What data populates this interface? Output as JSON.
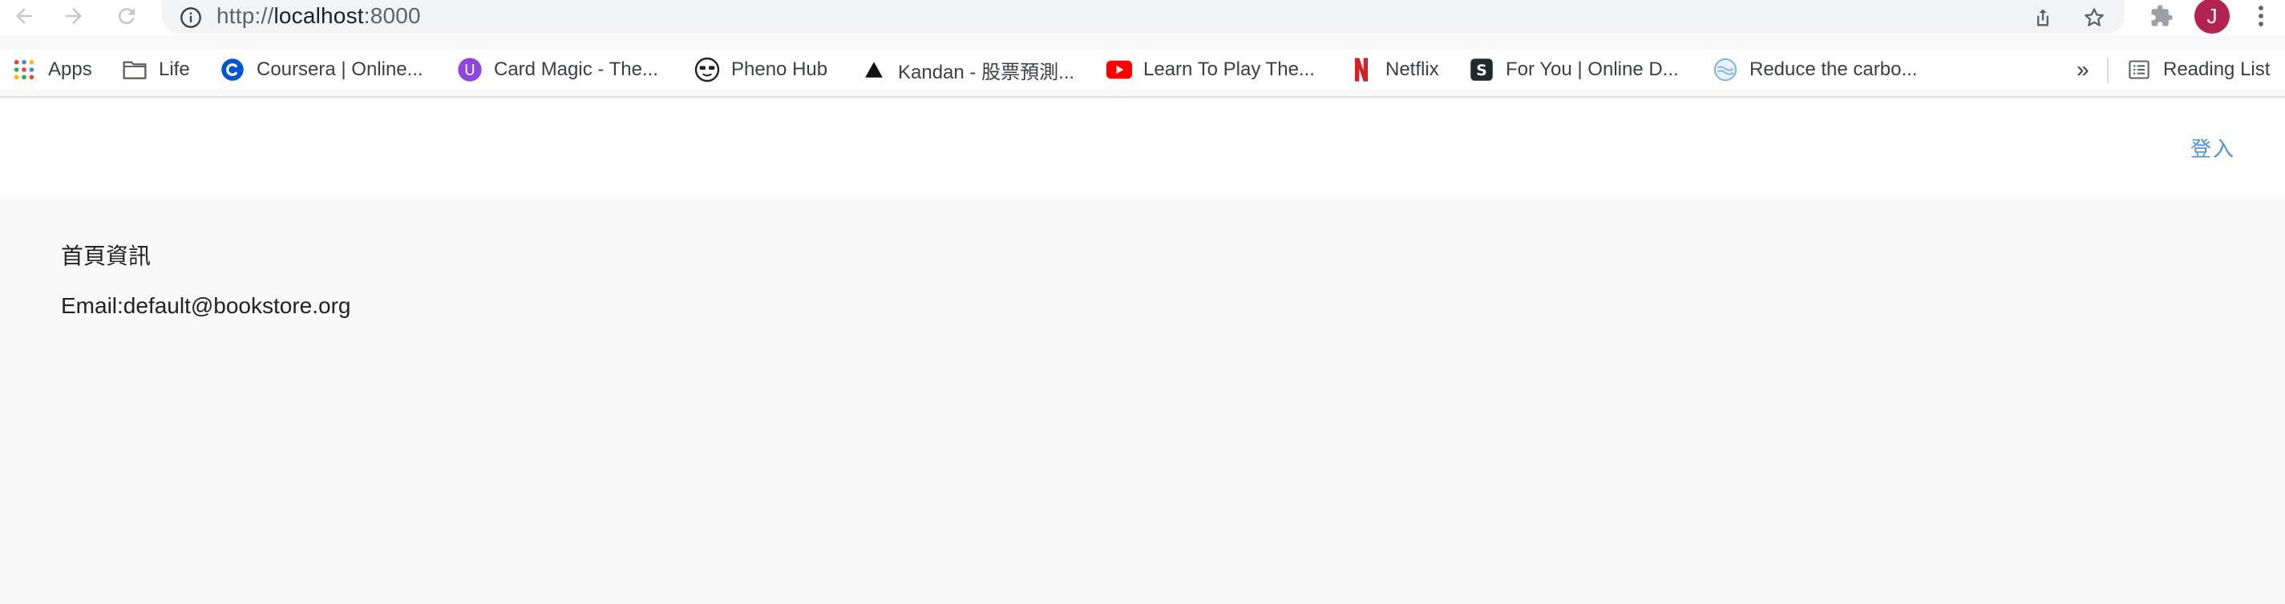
{
  "browser": {
    "url_prefix": "http://",
    "url_host": "localhost",
    "url_suffix": ":8000",
    "avatar_initial": "J"
  },
  "bookmarks": {
    "items": [
      {
        "label": "Apps",
        "icon": "apps-grid-icon"
      },
      {
        "label": "Life",
        "icon": "folder-icon"
      },
      {
        "label": "Coursera | Online...",
        "icon": "coursera-icon"
      },
      {
        "label": "Card Magic - The...",
        "icon": "card-magic-icon"
      },
      {
        "label": "Pheno Hub",
        "icon": "pheno-hub-icon"
      },
      {
        "label": "Kandan - 股票預測...",
        "icon": "kandan-icon"
      },
      {
        "label": "Learn To Play The...",
        "icon": "youtube-icon"
      },
      {
        "label": "Netflix",
        "icon": "netflix-icon"
      },
      {
        "label": "For You | Online D...",
        "icon": "scribd-icon"
      },
      {
        "label": "Reduce the carbo...",
        "icon": "globe-icon"
      }
    ],
    "overflow": "»",
    "reading_list": "Reading List"
  },
  "page": {
    "login": "登入",
    "home_title": "首頁資訊",
    "email_line": "Email:default@bookstore.org"
  },
  "colors": {
    "login_link": "#4a90d9",
    "avatar": "#b3234f",
    "page_bg": "#f9f9f9"
  }
}
